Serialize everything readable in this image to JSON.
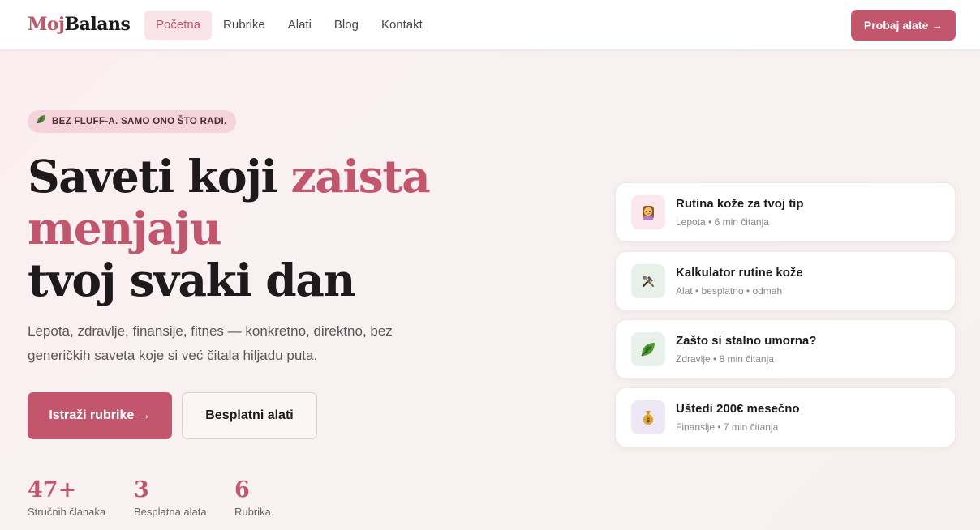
{
  "nav": {
    "logo_prefix": "Moj",
    "logo_suffix": "Balans",
    "links": [
      "Početna",
      "Rubrike",
      "Alati",
      "Blog",
      "Kontakt"
    ],
    "active_index": 0,
    "cta_label": "Probaj alate →"
  },
  "hero": {
    "badge": "BEZ FLUFF-A. SAMO ONO ŠTO RADI.",
    "title_part1": "Saveti koji ",
    "title_highlight": "zaista menjaju",
    "title_part2": "tvoj svaki dan",
    "subtitle": "Lepota, zdravlje, finansije, fitnes — konkretno, direktno, bez generičkih saveta koje si već čitala hiljadu puta.",
    "primary_button": "Istraži rubrike →",
    "secondary_button": "Besplatni alati"
  },
  "stats": [
    {
      "value": "47+",
      "label": "Stručnih članaka"
    },
    {
      "value": "3",
      "label": "Besplatna alata"
    },
    {
      "value": "6",
      "label": "Rubrika"
    }
  ],
  "cards": [
    {
      "title": "Rutina kože za tvoj tip",
      "meta": "Lepota • 6 min čitanja",
      "icon": "woman-face-icon"
    },
    {
      "title": "Kalkulator rutine kože",
      "meta": "Alat • besplatno • odmah",
      "icon": "tools-icon"
    },
    {
      "title": "Zašto si stalno umorna?",
      "meta": "Zdravlje • 8 min čitanja",
      "icon": "leaf-icon"
    },
    {
      "title": "Uštedi 200€ mesečno",
      "meta": "Finansije • 7 min čitanja",
      "icon": "money-bag-icon"
    }
  ],
  "colors": {
    "accent": "#c2566d",
    "text": "#1e1a1b",
    "muted": "#8f8689"
  }
}
